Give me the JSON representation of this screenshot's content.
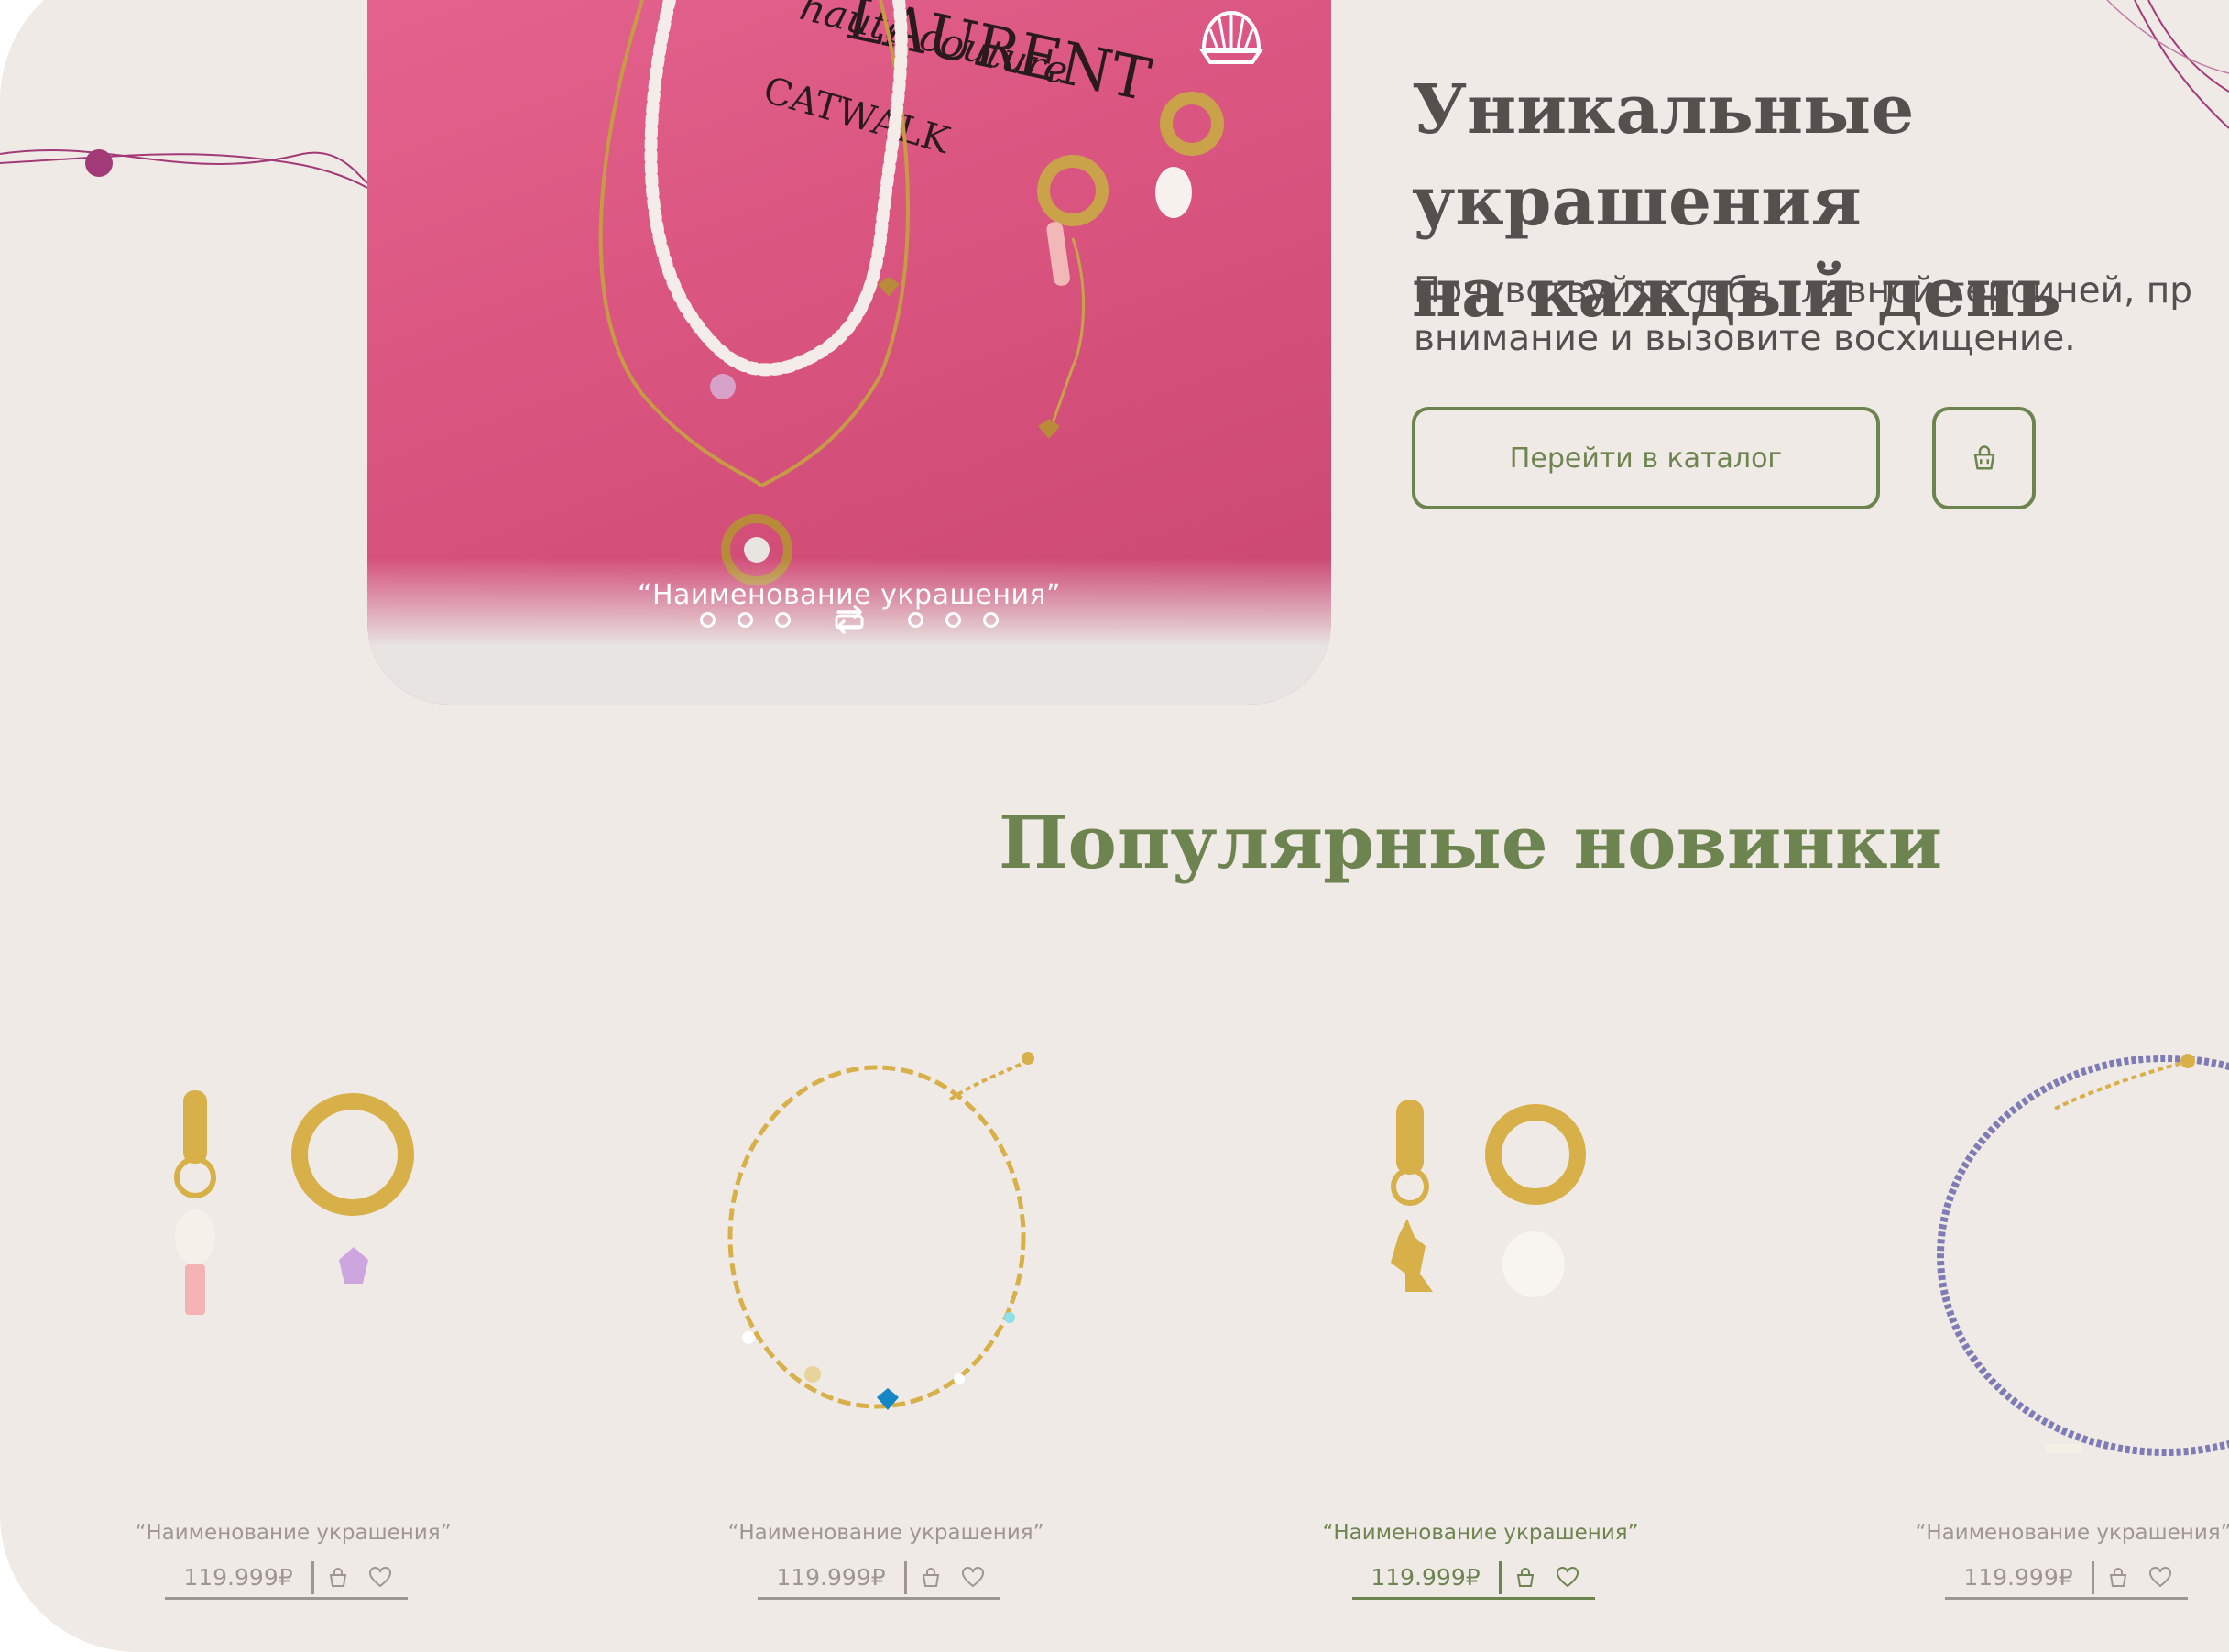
{
  "hero": {
    "caption": "“Наименование украшения”",
    "title": "Уникальные украшения\nна каждый день",
    "subtitle": "Почувствуйте себя главной героиней, пр\nвнимание и вызовите восхищение.",
    "catalog_button": "Перейти в каталог",
    "book_lines": [
      "LAURENT",
      "haute couture",
      "CATWALK"
    ]
  },
  "section": {
    "title": "Популярные новинки"
  },
  "products": [
    {
      "name": "“Наименование украшения”",
      "price": "119.999₽",
      "kind": "earrings-pearl"
    },
    {
      "name": "“Наименование украшения”",
      "price": "119.999₽",
      "kind": "bracelet-chain"
    },
    {
      "name": "“Наименование украшения”",
      "price": "119.999₽",
      "kind": "earrings-bunny",
      "active": true
    },
    {
      "name": "“Наименование украшения”",
      "price": "119.999₽",
      "kind": "bracelet-beads"
    }
  ],
  "colors": {
    "accent": "#6d8450",
    "background": "#efeae6",
    "muted": "#9d9692",
    "string": "#a33a78",
    "card": "#dc5a85"
  },
  "icons": [
    "shell-logo-icon",
    "cart-icon",
    "heart-icon",
    "slider-arrows-icon"
  ]
}
